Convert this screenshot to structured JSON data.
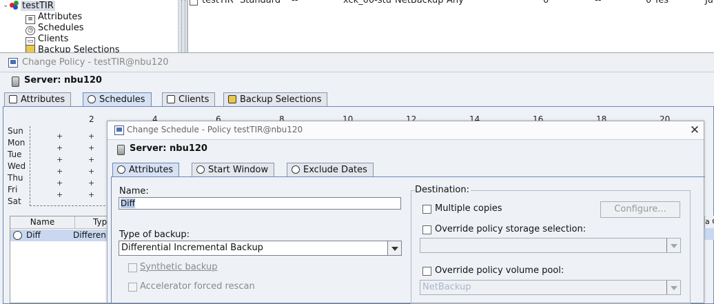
{
  "tree": {
    "root": "testTIR",
    "items": [
      "Attributes",
      "Schedules",
      "Clients",
      "Backup Selections"
    ]
  },
  "top_table": {
    "row": [
      "testTIR",
      "Standard",
      "--",
      "xck_00-stu",
      "NetBackup",
      "Any",
      "0",
      "--",
      "0",
      "Yes",
      "Ja"
    ]
  },
  "policy_window": {
    "title": "Change Policy - testTIR@nbu120",
    "server_label": "Server: nbu120",
    "tabs": [
      "Attributes",
      "Schedules",
      "Clients",
      "Backup Selections"
    ]
  },
  "calendar": {
    "hours": [
      "2",
      "4",
      "6",
      "8",
      "10",
      "12",
      "14",
      "16",
      "18",
      "20"
    ],
    "days": [
      "Sun",
      "Mon",
      "Tue",
      "Wed",
      "Thu",
      "Fri",
      "Sat"
    ]
  },
  "schedule_table": {
    "headers": [
      "Name",
      "Typ"
    ],
    "row_name": "Diff",
    "row_type": "Differen",
    "right_edge_text": "a C"
  },
  "dialog": {
    "title": "Change Schedule - Policy testTIR@nbu120",
    "server_label": "Server: nbu120",
    "tabs": [
      "Attributes",
      "Start Window",
      "Exclude Dates"
    ],
    "name_label": "Name:",
    "name_value": "Diff",
    "type_label": "Type of backup:",
    "type_value": "Differential Incremental Backup",
    "synthetic_label": "Synthetic backup",
    "accelerator_label": "Accelerator forced rescan",
    "destination_label": "Destination:",
    "multiple_copies_label": "Multiple copies",
    "configure_label": "Configure...",
    "override_storage_label": "Override policy storage selection:",
    "override_volume_label": "Override policy volume pool:",
    "volume_pool_value": "NetBackup"
  }
}
